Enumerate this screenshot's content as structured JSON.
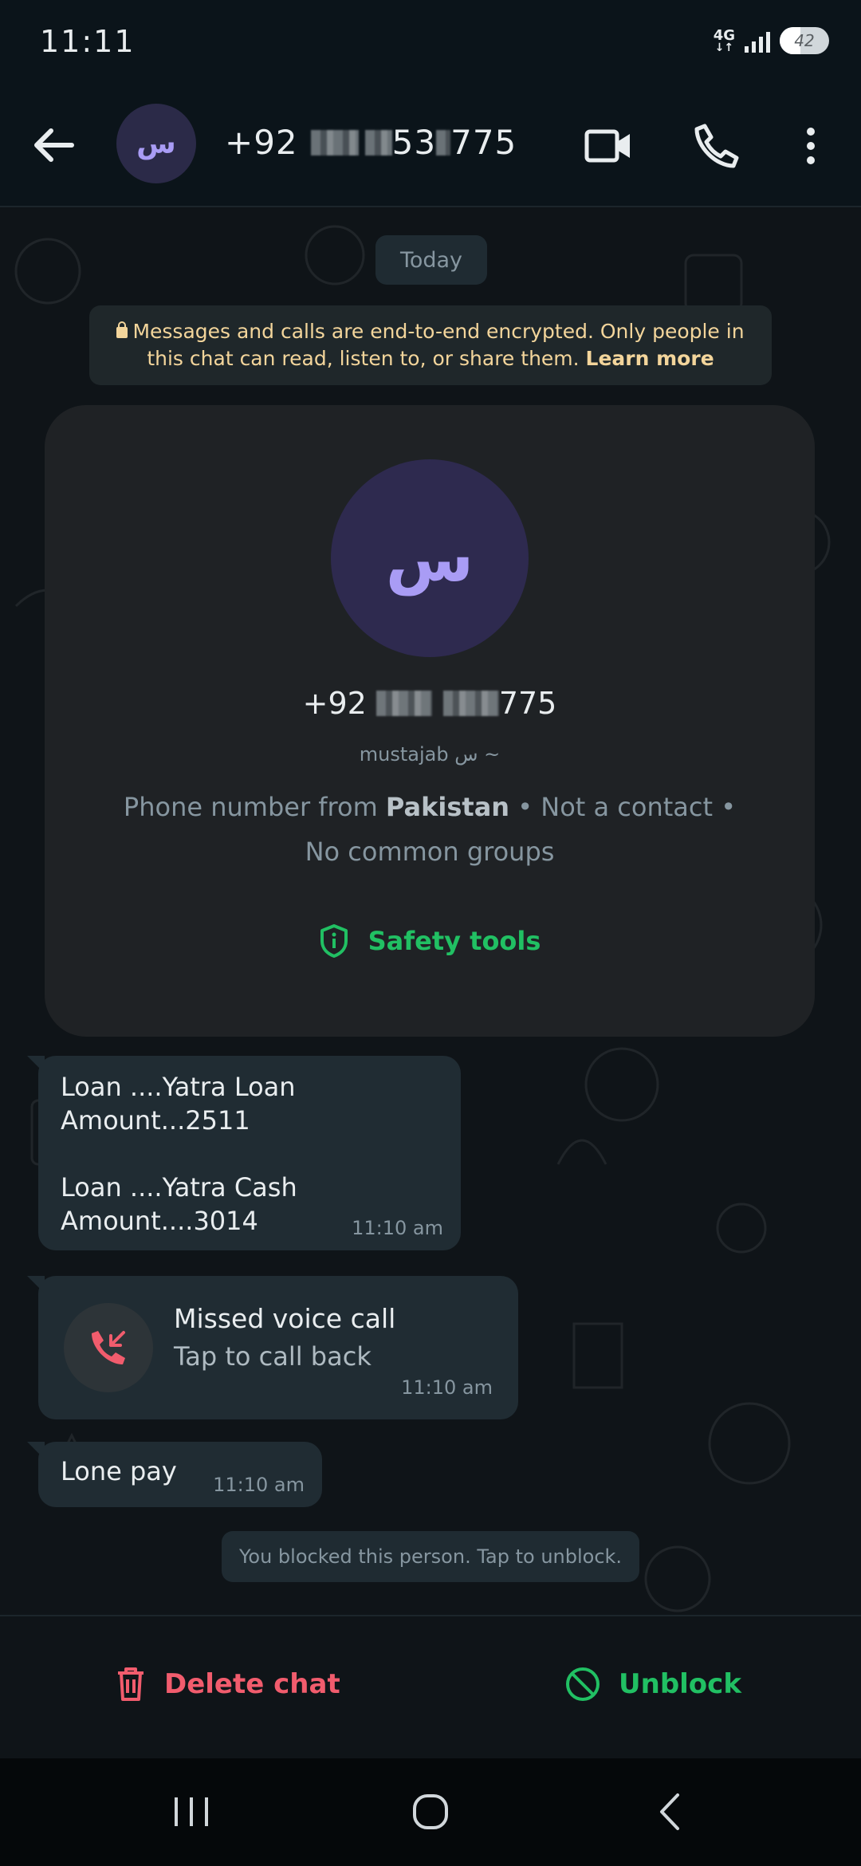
{
  "status_bar": {
    "time": "11:11",
    "network": "4G",
    "battery_level": "42"
  },
  "header": {
    "avatar_letter": "س",
    "phone_prefix": "+92",
    "phone_suffix_1": "53",
    "phone_suffix_2": "775",
    "icons": [
      "back-arrow-icon",
      "video-call-icon",
      "phone-icon",
      "more-vert-icon"
    ]
  },
  "chat": {
    "date_chip": "Today",
    "encryption_line1": "Messages and calls are end-to-end encrypted. Only people in",
    "encryption_line2": "this chat can read, listen to, or share them.",
    "learn_more": "Learn more",
    "contact_card": {
      "avatar_letter": "س",
      "phone_prefix": "+92",
      "phone_suffix": "775",
      "push_name": "mustajab س ~",
      "info_prefix": "Phone number from",
      "info_country": "Pakistan",
      "info_suffix": "• Not a contact • No common groups",
      "safety_tools": "Safety tools"
    },
    "messages": [
      {
        "text": "Loan ....Yatra Loan\nAmount...2511\n\nLoan ....Yatra Cash\nAmount....3014",
        "time": "11:10 am"
      },
      {
        "call_title": "Missed voice call",
        "call_subtitle": "Tap to call back",
        "time": "11:10 am"
      },
      {
        "text": "Lone pay",
        "time": "11:10 am"
      }
    ],
    "blocked_note": "You blocked this person. Tap to unblock."
  },
  "actions": {
    "delete_chat": "Delete chat",
    "unblock": "Unblock"
  },
  "colors": {
    "background": "#0b141a",
    "bubble": "#202c33",
    "accent_green": "#21c063",
    "danger_red": "#f15c6d",
    "encryption_text": "#f3d59b",
    "avatar_purple": "#a99cf5"
  }
}
